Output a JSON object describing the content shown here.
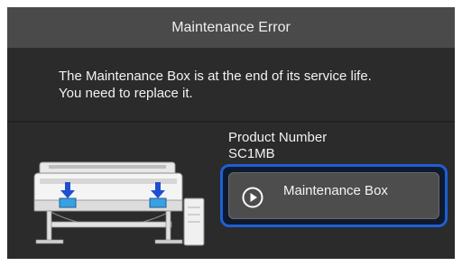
{
  "dialog": {
    "title": "Maintenance Error",
    "message_line1": "The Maintenance Box is at the end of its service life.",
    "message_line2": "You need to replace it.",
    "product_number_label": "Product Number",
    "product_number_value": "SC1MB",
    "button_label": "Maintenance Box"
  },
  "icons": {
    "button_icon": "play-circle-icon",
    "illustration": "large-format-printer-illustration",
    "indicator": "down-arrow-icon"
  },
  "colors": {
    "background": "#2b2b2b",
    "titlebar": "#4a4a4a",
    "focus_ring": "#1e5fd6",
    "button": "#4d4d4d",
    "indicator_arrow": "#1e4fd0"
  }
}
